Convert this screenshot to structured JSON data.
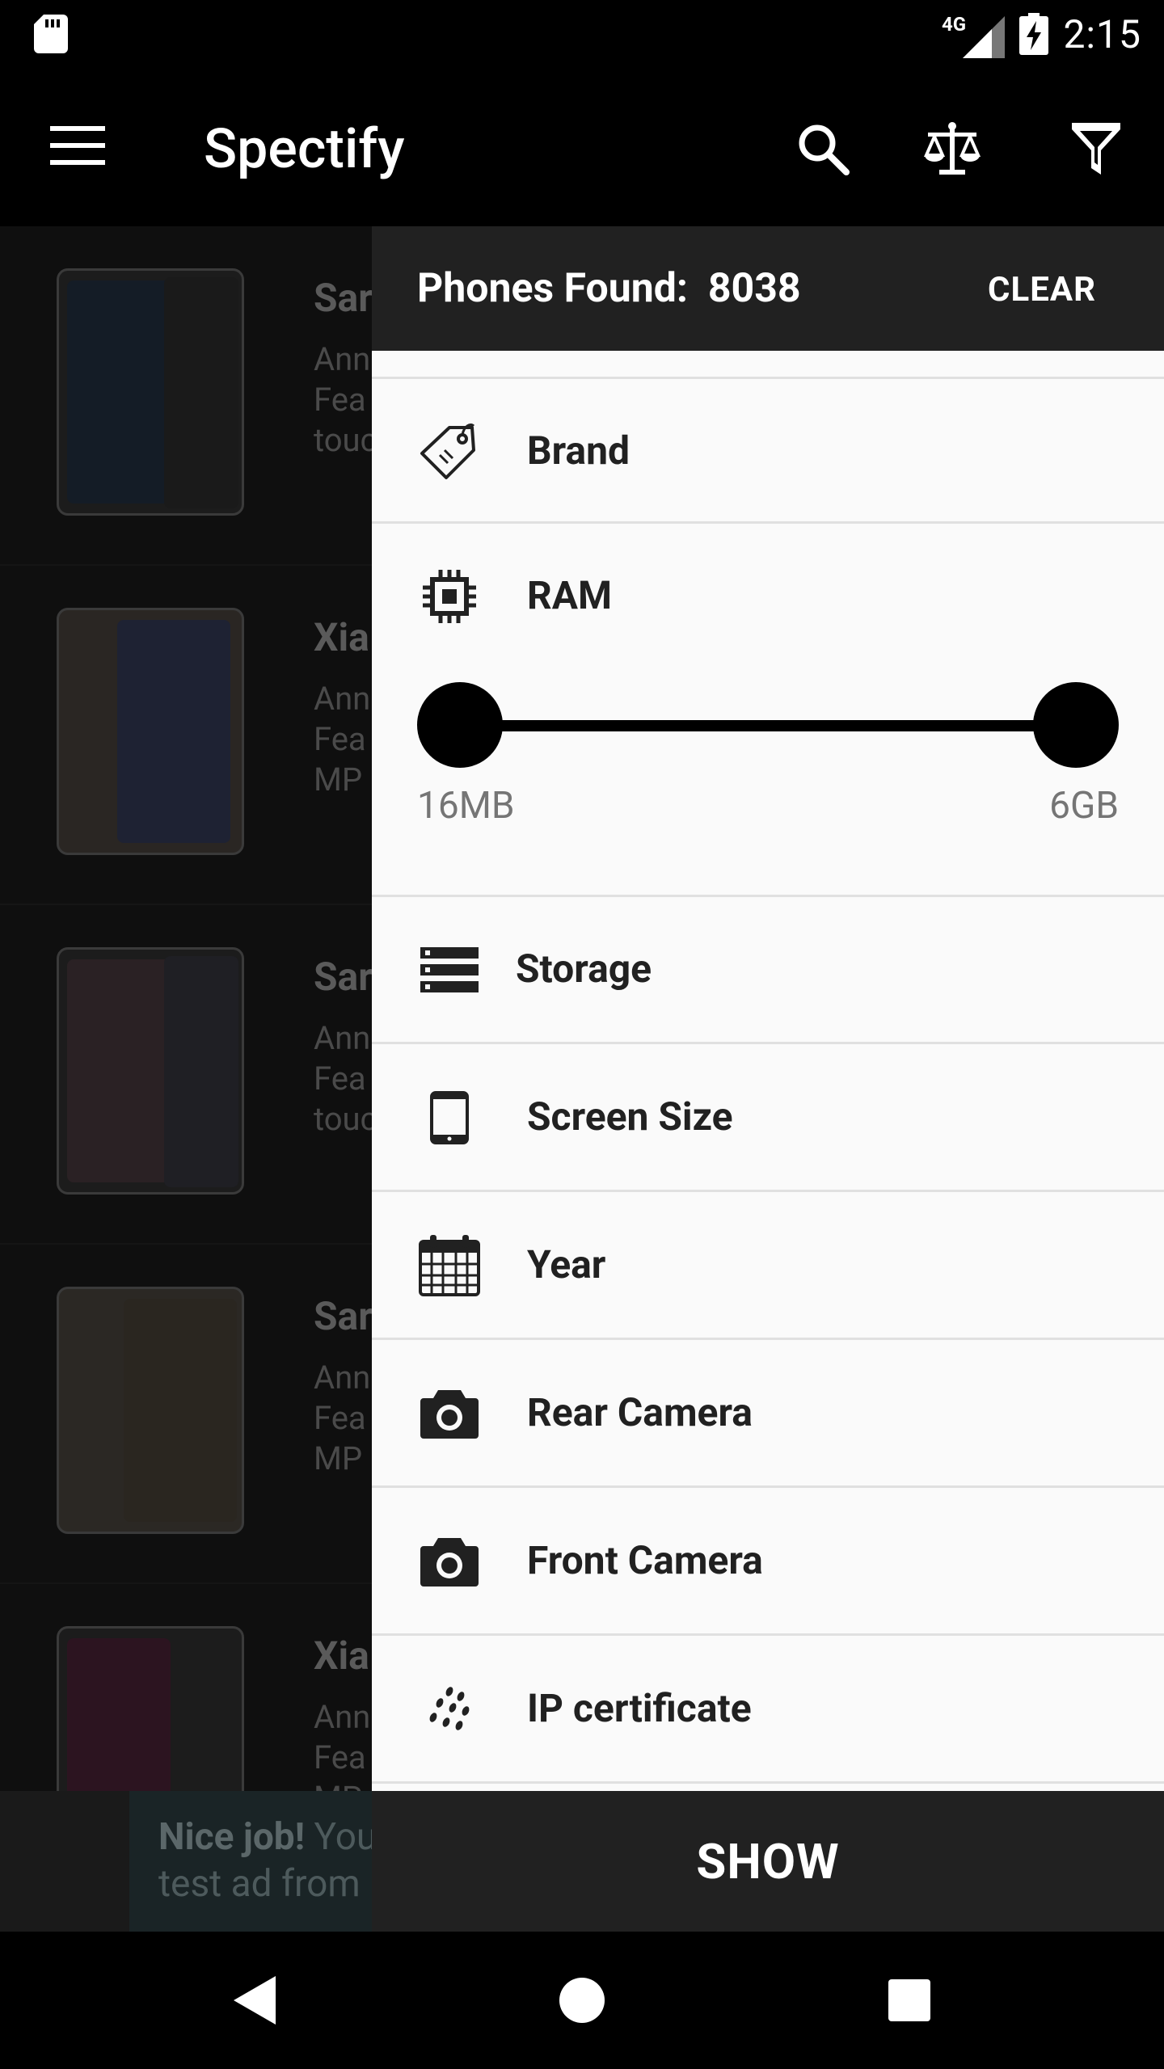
{
  "status_bar": {
    "network": "4G",
    "time": "2:15"
  },
  "app_bar": {
    "title": "Spectify",
    "icons": [
      "menu-icon",
      "search-icon",
      "compare-scale-icon",
      "filter-icon"
    ]
  },
  "phone_list": [
    {
      "title": "Sar",
      "desc": [
        "Ann",
        "Fea",
        "touc"
      ]
    },
    {
      "title": "Xia",
      "desc": [
        "Ann",
        "Fea",
        "MP"
      ]
    },
    {
      "title": "Sar",
      "desc": [
        "Ann",
        "Fea",
        "touc"
      ]
    },
    {
      "title": "Sar",
      "desc": [
        "Ann",
        "Fea",
        "MP"
      ]
    },
    {
      "title": "Xia",
      "desc": [
        "Ann",
        "Fea",
        "MP"
      ]
    }
  ],
  "ad": {
    "bold": "Nice job!",
    "line1_rest": " You",
    "line2": "test ad from"
  },
  "filter_drawer": {
    "found_label": "Phones Found:",
    "found_count": "8038",
    "clear_label": "CLEAR",
    "items": [
      {
        "label": "Brand",
        "icon": "tag-icon"
      },
      {
        "label": "RAM",
        "icon": "chip-icon"
      },
      {
        "label": "Storage",
        "icon": "storage-icon"
      },
      {
        "label": "Screen Size",
        "icon": "phone-screen-icon"
      },
      {
        "label": "Year",
        "icon": "calendar-icon"
      },
      {
        "label": "Rear Camera",
        "icon": "camera-icon"
      },
      {
        "label": "Front Camera",
        "icon": "camera-icon"
      },
      {
        "label": "IP certificate",
        "icon": "water-drops-icon"
      }
    ],
    "ram_range": {
      "min_label": "16MB",
      "max_label": "6GB",
      "selected_low_fraction": 0.0,
      "selected_high_fraction": 1.0
    },
    "show_label": "SHOW"
  },
  "nav_bar": {
    "icons": [
      "back-icon",
      "home-icon",
      "recents-icon"
    ]
  },
  "colors": {
    "drawer_bg": "#fafafa",
    "header_bg": "#212121",
    "app_bar_bg": "#000000"
  }
}
